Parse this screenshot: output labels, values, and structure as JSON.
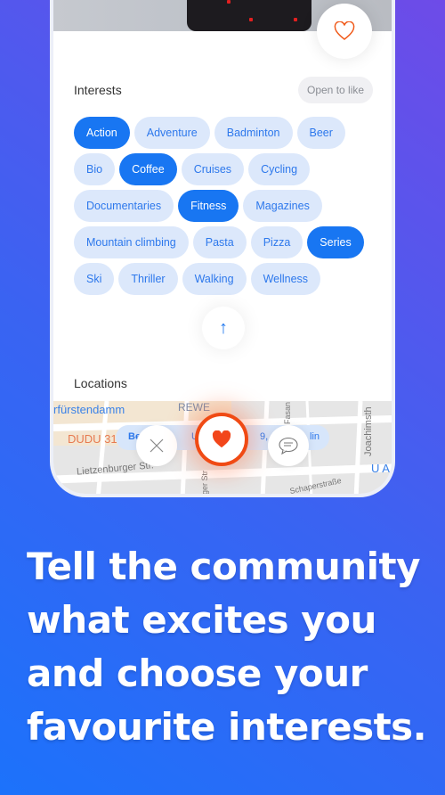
{
  "profile": {
    "like_icon": "heart-outline-icon"
  },
  "interests": {
    "title": "Interests",
    "open_to_like": "Open to like",
    "chips": [
      {
        "label": "Action",
        "selected": true
      },
      {
        "label": "Adventure",
        "selected": false
      },
      {
        "label": "Badminton",
        "selected": false
      },
      {
        "label": "Beer",
        "selected": false
      },
      {
        "label": "Bio",
        "selected": false
      },
      {
        "label": "Coffee",
        "selected": true
      },
      {
        "label": "Cruises",
        "selected": false
      },
      {
        "label": "Cycling",
        "selected": false
      },
      {
        "label": "Documentaries",
        "selected": false
      },
      {
        "label": "Fitness",
        "selected": true
      },
      {
        "label": "Magazines",
        "selected": false
      },
      {
        "label": "Mountain climbing",
        "selected": false
      },
      {
        "label": "Pasta",
        "selected": false
      },
      {
        "label": "Pizza",
        "selected": false
      },
      {
        "label": "Series",
        "selected": true
      },
      {
        "label": "Ski",
        "selected": false
      },
      {
        "label": "Thriller",
        "selected": false
      },
      {
        "label": "Walking",
        "selected": false
      },
      {
        "label": "Wellness",
        "selected": false
      }
    ],
    "scroll_up_icon": "arrow-up-icon"
  },
  "locations": {
    "title": "Locations",
    "address_fragments": [
      "Be",
      "Uhla",
      "9, 10",
      "lin"
    ],
    "map_labels": {
      "kurfuerstendamm": "rfürstendamm",
      "rewe": "REWE",
      "dudu": "DUDU 31",
      "lietzenburger": "Lietzenburger Str.",
      "fasan": "Fasan",
      "joachimsthaler": "Joachimsth",
      "schaper": "Schaperstraße",
      "ua": "U A",
      "ger_str": "ger Str"
    }
  },
  "actions": {
    "dismiss_icon": "close-icon",
    "like_icon": "heart-filled-icon",
    "message_icon": "chat-bubble-icon"
  },
  "headline": "Tell the community what excites you and choose your favourite interests.",
  "colors": {
    "accent": "#1876f2",
    "chip_bg": "#dce8fb",
    "like": "#f04a14",
    "bg_start": "#1c72fb",
    "bg_end": "#6e4be8"
  }
}
